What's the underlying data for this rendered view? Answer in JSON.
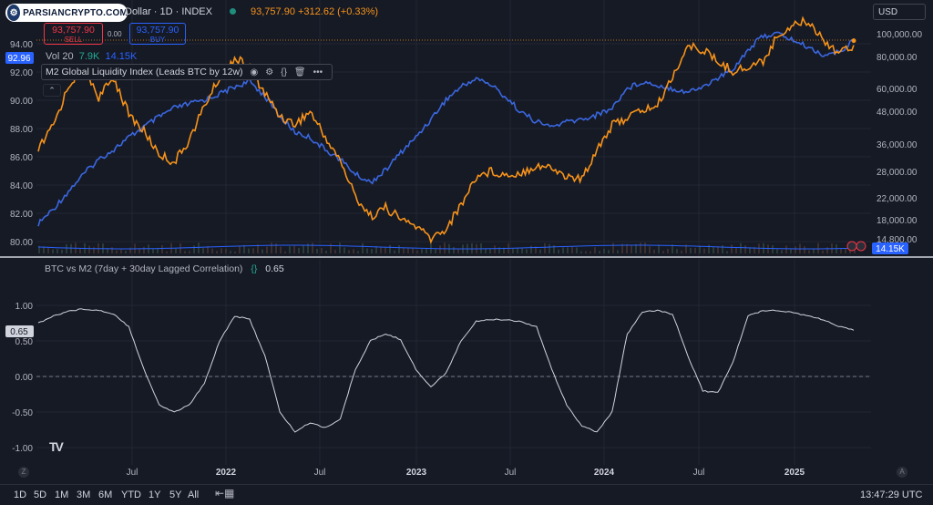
{
  "header": {
    "logo_text": "PARSIANCRYPTO.COM",
    "symbol": "Dollar · 1D · INDEX",
    "price_line": "93,757.90 +312.62 (+0.33%)",
    "currency": "USD"
  },
  "trade": {
    "sell_price": "93,757.90",
    "sell_label": "SELL",
    "spread": "0.00",
    "buy_price": "93,757.90",
    "buy_label": "BUY"
  },
  "volume": {
    "label": "Vol 20",
    "v1": "7.9K",
    "v2": "14.15K"
  },
  "indicator": {
    "name": "M2 Global Liquidity Index (Leads BTC by 12w)",
    "icons": [
      "eye-icon",
      "settings-icon",
      "braces-icon",
      "trash-icon",
      "more-icon"
    ],
    "collapse_glyph": "⌃"
  },
  "lower_indicator": {
    "name": "BTC vs M2 (7day + 30day Lagged Correlation)",
    "braces": "{}",
    "value": "0.65"
  },
  "timeframes": [
    "1D",
    "5D",
    "1M",
    "3M",
    "6M",
    "YTD",
    "1Y",
    "5Y",
    "All"
  ],
  "clock": "13:47:29 UTC",
  "left_axis": {
    "ticks": [
      "94.00",
      "92.00",
      "90.00",
      "88.00",
      "86.00",
      "84.00",
      "82.00",
      "80.00"
    ],
    "highlight": "92.96"
  },
  "right_axis": {
    "ticks": [
      "100,000.00",
      "80,000.00",
      "60,000.00",
      "48,000.00",
      "36,000.00",
      "28,000.00",
      "22,000.00",
      "18,000.00",
      "14,800.00"
    ],
    "highlight": "14.15K"
  },
  "corr_axis": {
    "ticks": [
      "1.00",
      "0.50",
      "0.00",
      "-0.50",
      "-1.00"
    ],
    "highlight": "0.65"
  },
  "time_axis": [
    "Jul",
    "2022",
    "Jul",
    "2023",
    "Jul",
    "2024",
    "Jul",
    "2025"
  ],
  "chart_data": {
    "type": "line",
    "x_range": [
      "2021-01",
      "2025-04"
    ],
    "series": [
      {
        "name": "M2 Global Liquidity Index (Leads BTC by 12w)",
        "color": "#f7931a",
        "axis": "left",
        "values": [
          86.5,
          88.2,
          91.0,
          92.5,
          90.2,
          91.6,
          89.0,
          87.8,
          86.2,
          85.6,
          87.2,
          89.6,
          91.6,
          93.0,
          92.3,
          90.5,
          88.9,
          88.3,
          89.2,
          87.4,
          85.7,
          83.2,
          81.8,
          82.4,
          81.6,
          81.1,
          80.2,
          80.9,
          82.6,
          84.6,
          85.0,
          84.7,
          84.9,
          85.4,
          85.2,
          84.6,
          84.4,
          86.6,
          88.2,
          88.8,
          89.3,
          89.6,
          91.7,
          93.8,
          93.6,
          92.7,
          92.1,
          92.3,
          92.8,
          94.6,
          95.4,
          95.6,
          94.3,
          93.4,
          93.9
        ]
      },
      {
        "name": "BTC",
        "color": "#3a67e0",
        "axis": "right",
        "values": [
          17000,
          19500,
          23000,
          27000,
          31000,
          34000,
          38000,
          42000,
          46000,
          50000,
          52000,
          54000,
          57000,
          61000,
          64000,
          56000,
          46000,
          40000,
          38000,
          34000,
          31000,
          27000,
          25000,
          28000,
          33000,
          38000,
          45000,
          54000,
          61000,
          66000,
          62000,
          55000,
          48000,
          44000,
          42000,
          44000,
          45000,
          47000,
          50000,
          60000,
          64000,
          62000,
          60000,
          58000,
          61000,
          66000,
          72000,
          86000,
          98000,
          100000,
          94000,
          88000,
          82000,
          84000,
          93757.9
        ]
      }
    ],
    "correlation": {
      "name": "BTC vs M2 (7day + 30day Lagged Correlation)",
      "color": "#d1d4dc",
      "ylim": [
        -1.1,
        1.4
      ],
      "values": [
        0.75,
        0.85,
        0.92,
        0.95,
        0.93,
        0.88,
        0.7,
        0.1,
        -0.4,
        -0.5,
        -0.4,
        -0.1,
        0.5,
        0.85,
        0.8,
        0.3,
        -0.5,
        -0.78,
        -0.65,
        -0.72,
        -0.6,
        0.1,
        0.5,
        0.6,
        0.52,
        0.1,
        -0.15,
        0.05,
        0.5,
        0.78,
        0.8,
        0.8,
        0.77,
        0.7,
        0.1,
        -0.4,
        -0.7,
        -0.78,
        -0.5,
        0.6,
        0.9,
        0.93,
        0.88,
        0.3,
        -0.2,
        -0.23,
        0.2,
        0.85,
        0.93,
        0.93,
        0.9,
        0.85,
        0.8,
        0.7,
        0.65
      ]
    }
  }
}
